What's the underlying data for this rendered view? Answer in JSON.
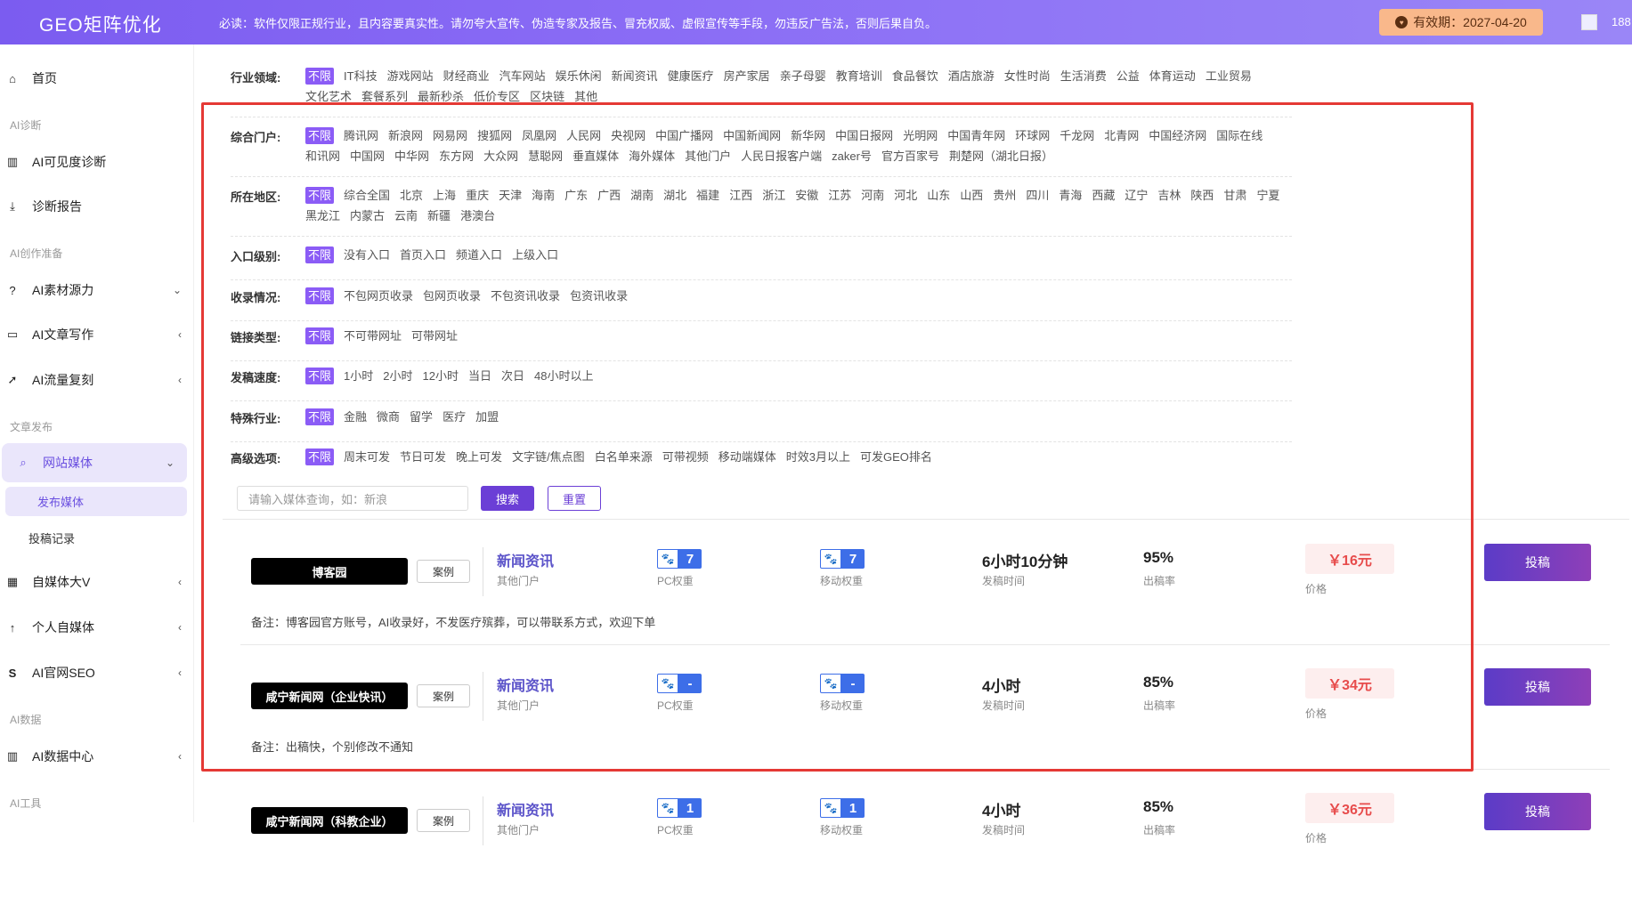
{
  "header": {
    "logo": "GEO矩阵优化",
    "notice": "必读：软件仅限正规行业，且内容要真实性。请勿夸大宣传、伪造专家及报告、冒充权威、虚假宣传等手段，勿违反广告法，否则后果自负。",
    "validity": "有效期：2027-04-20",
    "user_num": "188"
  },
  "sidebar": {
    "home": "首页",
    "sec_diag": "AI诊断",
    "visibility": "AI可见度诊断",
    "report": "诊断报告",
    "sec_create": "AI创作准备",
    "material": "AI素材源力",
    "article": "AI文章写作",
    "traffic": "AI流量复刻",
    "sec_publish": "文章发布",
    "website_media": "网站媒体",
    "publish_media": "发布媒体",
    "submit_record": "投稿记录",
    "selfmedia_v": "自媒体大V",
    "personal_media": "个人自媒体",
    "seo": "AI官网SEO",
    "sec_data": "AI数据",
    "data_center": "AI数据中心",
    "sec_tools": "AI工具"
  },
  "filters": [
    {
      "label": "行业领域:",
      "options": [
        "不限",
        "IT科技",
        "游戏网站",
        "财经商业",
        "汽车网站",
        "娱乐休闲",
        "新闻资讯",
        "健康医疗",
        "房产家居",
        "亲子母婴",
        "教育培训",
        "食品餐饮",
        "酒店旅游",
        "女性时尚",
        "生活消费",
        "公益",
        "体育运动",
        "工业贸易",
        "文化艺术",
        "套餐系列",
        "最新秒杀",
        "低价专区",
        "区块链",
        "其他"
      ]
    },
    {
      "label": "综合门户:",
      "options": [
        "不限",
        "腾讯网",
        "新浪网",
        "网易网",
        "搜狐网",
        "凤凰网",
        "人民网",
        "央视网",
        "中国广播网",
        "中国新闻网",
        "新华网",
        "中国日报网",
        "光明网",
        "中国青年网",
        "环球网",
        "千龙网",
        "北青网",
        "中国经济网",
        "国际在线",
        "和讯网",
        "中国网",
        "中华网",
        "东方网",
        "大众网",
        "慧聪网",
        "垂直媒体",
        "海外媒体",
        "其他门户",
        "人民日报客户端",
        "zaker号",
        "官方百家号",
        "荆楚网（湖北日报）"
      ]
    },
    {
      "label": "所在地区:",
      "options": [
        "不限",
        "综合全国",
        "北京",
        "上海",
        "重庆",
        "天津",
        "海南",
        "广东",
        "广西",
        "湖南",
        "湖北",
        "福建",
        "江西",
        "浙江",
        "安徽",
        "江苏",
        "河南",
        "河北",
        "山东",
        "山西",
        "贵州",
        "四川",
        "青海",
        "西藏",
        "辽宁",
        "吉林",
        "陕西",
        "甘肃",
        "宁夏",
        "黑龙江",
        "内蒙古",
        "云南",
        "新疆",
        "港澳台"
      ]
    },
    {
      "label": "入口级别:",
      "options": [
        "不限",
        "没有入口",
        "首页入口",
        "频道入口",
        "上级入口"
      ]
    },
    {
      "label": "收录情况:",
      "options": [
        "不限",
        "不包网页收录",
        "包网页收录",
        "不包资讯收录",
        "包资讯收录"
      ]
    },
    {
      "label": "链接类型:",
      "options": [
        "不限",
        "不可带网址",
        "可带网址"
      ]
    },
    {
      "label": "发稿速度:",
      "options": [
        "不限",
        "1小时",
        "2小时",
        "12小时",
        "当日",
        "次日",
        "48小时以上"
      ]
    },
    {
      "label": "特殊行业:",
      "options": [
        "不限",
        "金融",
        "微商",
        "留学",
        "医疗",
        "加盟"
      ]
    },
    {
      "label": "高级选项:",
      "options": [
        "不限",
        "周末可发",
        "节日可发",
        "晚上可发",
        "文字链/焦点图",
        "白名单来源",
        "可带视频",
        "移动端媒体",
        "时效3月以上",
        "可发GEO排名"
      ]
    }
  ],
  "search": {
    "placeholder": "请输入媒体查询，如：新浪",
    "search_btn": "搜索",
    "reset_btn": "重置"
  },
  "labels": {
    "case": "案例",
    "pc_weight": "PC权重",
    "mobile_weight": "移动权重",
    "publish_time": "发稿时间",
    "publish_rate": "出稿率",
    "price": "价格",
    "submit": "投稿"
  },
  "media": [
    {
      "name": "博客园",
      "category": "新闻资讯",
      "sub": "其他门户",
      "pc": "7",
      "mobile": "7",
      "time": "6小时10分钟",
      "rate": "95%",
      "price": "￥16元",
      "remark": "备注：博客园官方账号，AI收录好，不发医疗殡葬，可以带联系方式，欢迎下单"
    },
    {
      "name": "咸宁新闻网（企业快讯）",
      "category": "新闻资讯",
      "sub": "其他门户",
      "pc": "-",
      "mobile": "-",
      "time": "4小时",
      "rate": "85%",
      "price": "￥34元",
      "remark": "备注：出稿快，个别修改不通知"
    },
    {
      "name": "咸宁新闻网（科教企业）",
      "category": "新闻资讯",
      "sub": "其他门户",
      "pc": "1",
      "mobile": "1",
      "time": "4小时",
      "rate": "85%",
      "price": "￥36元",
      "remark": ""
    }
  ]
}
